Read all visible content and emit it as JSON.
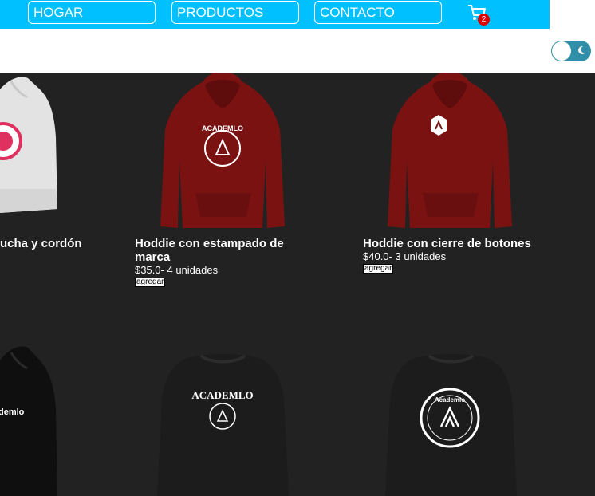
{
  "nav": {
    "home_label": "HOGAR",
    "products_label": "PRODUCTOS",
    "contact_label": "CONTACTO",
    "cart_icon": "cart-icon",
    "cart_count": "2",
    "bg_color": "#00c0ff"
  },
  "theme_toggle": {
    "icon": "moon-icon"
  },
  "products": [
    {
      "title": "ucha y cordón",
      "color": "#e0e0e0"
    },
    {
      "title": "Hoddie con estampado de marca",
      "price": "$35.0- 4 unidades",
      "add_label": "agregar",
      "color": "#7a1010",
      "print": "ACADEMLO"
    },
    {
      "title": "Hoddie con cierre de botones",
      "price": "$40.0- 3 unidades",
      "add_label": "agregar",
      "color": "#7a1010"
    },
    {
      "print": "demlo",
      "color": "#111111"
    },
    {
      "print": "ACADEMLO",
      "color": "#1c1c1c"
    },
    {
      "print": "Academlo",
      "color": "#1c1c1c"
    }
  ]
}
